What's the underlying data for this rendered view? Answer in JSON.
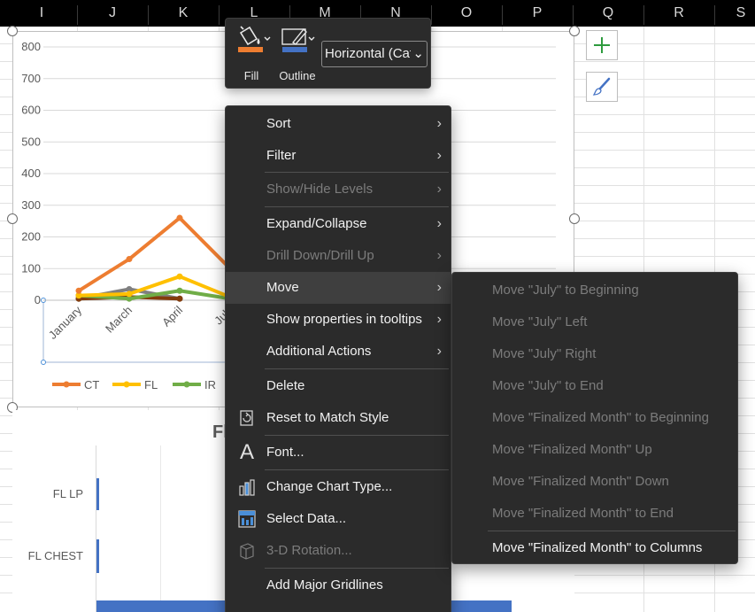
{
  "columns": [
    "I",
    "J",
    "K",
    "L",
    "M",
    "N",
    "O",
    "P",
    "Q",
    "R",
    "S"
  ],
  "mini_toolbar": {
    "fill_label": "Fill",
    "outline_label": "Outline",
    "element_selector": "Horizontal (Cat",
    "fill_color": "#ed7d31",
    "outline_color": "#4472c4"
  },
  "side_buttons": {
    "chart_elements": "plus-icon",
    "chart_styles": "brush-icon"
  },
  "context_menu": {
    "items": [
      {
        "label": "Sort",
        "submenu": true,
        "enabled": true
      },
      {
        "label": "Filter",
        "submenu": true,
        "enabled": true
      },
      {
        "label": "Show/Hide Levels",
        "submenu": true,
        "enabled": false
      },
      {
        "label": "Expand/Collapse",
        "submenu": true,
        "enabled": true
      },
      {
        "label": "Drill Down/Drill Up",
        "submenu": true,
        "enabled": false
      },
      {
        "label": "Move",
        "submenu": true,
        "enabled": true,
        "highlighted": true
      },
      {
        "label": "Show properties in tooltips",
        "submenu": true,
        "enabled": true
      },
      {
        "label": "Additional Actions",
        "submenu": true,
        "enabled": true
      },
      {
        "label": "Delete",
        "enabled": true
      },
      {
        "label": "Reset to Match Style",
        "enabled": true,
        "icon": "reset-style-icon"
      },
      {
        "label": "Font...",
        "enabled": true,
        "icon": "font-icon"
      },
      {
        "label": "Change Chart Type...",
        "enabled": true,
        "icon": "chart-type-icon"
      },
      {
        "label": "Select Data...",
        "enabled": true,
        "icon": "select-data-icon"
      },
      {
        "label": "3-D Rotation...",
        "enabled": false,
        "icon": "rotation-3d-icon"
      },
      {
        "label": "Add Major Gridlines",
        "enabled": true
      }
    ]
  },
  "move_submenu": {
    "items": [
      {
        "label": "Move \"July\" to Beginning",
        "enabled": false
      },
      {
        "label": "Move \"July\" Left",
        "enabled": false
      },
      {
        "label": "Move \"July\" Right",
        "enabled": false
      },
      {
        "label": "Move \"July\" to End",
        "enabled": false
      },
      {
        "label": "Move \"Finalized Month\" to Beginning",
        "enabled": false
      },
      {
        "label": "Move \"Finalized Month\" Up",
        "enabled": false
      },
      {
        "label": "Move \"Finalized Month\" Down",
        "enabled": false
      },
      {
        "label": "Move \"Finalized Month\" to End",
        "enabled": false
      },
      {
        "label": "Move \"Finalized Month\" to Columns",
        "enabled": true
      }
    ]
  },
  "chart_data": [
    {
      "type": "line",
      "categories": [
        "January",
        "March",
        "April",
        "July"
      ],
      "ylim": [
        0,
        800
      ],
      "yticks": [
        "800",
        "700",
        "600",
        "500",
        "400",
        "300",
        "200",
        "100",
        "0"
      ],
      "grid": true,
      "legend_position": "bottom",
      "series": [
        {
          "name": "CT",
          "color": "#ed7d31",
          "values": [
            30,
            130,
            260,
            100
          ]
        },
        {
          "name": "FL",
          "color": "#ffc000",
          "values": [
            15,
            20,
            75,
            10
          ]
        },
        {
          "name": "IR",
          "color": "#70ad47",
          "values": [
            15,
            5,
            30,
            5
          ]
        },
        {
          "name": "",
          "color": "#843c0c",
          "values": [
            5,
            10,
            5,
            null
          ]
        },
        {
          "name": "",
          "color": "#7f7f7f",
          "values": [
            5,
            35,
            5,
            null
          ]
        }
      ],
      "hidden_point_color": "#843c0c"
    },
    {
      "type": "bar",
      "title": "Fl",
      "categories": [
        "FL LP",
        "FL CHEST"
      ]
    }
  ]
}
